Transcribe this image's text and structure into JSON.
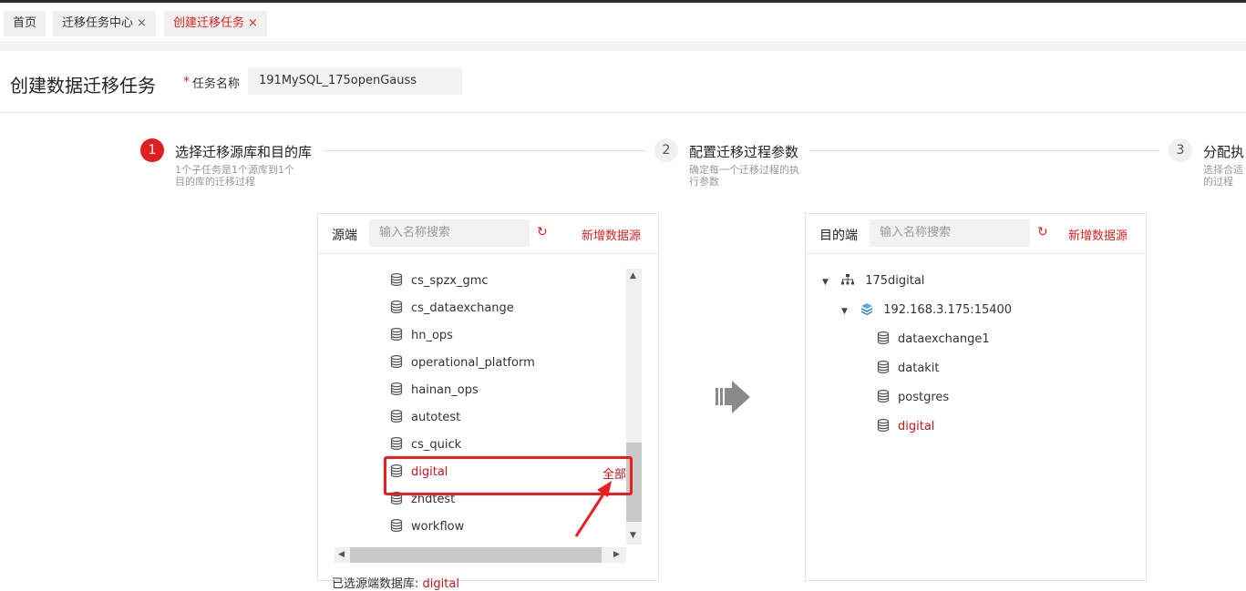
{
  "tabs": [
    {
      "label": "首页",
      "closable": false,
      "active": false
    },
    {
      "label": "迁移任务中心",
      "closable": true,
      "active": false
    },
    {
      "label": "创建迁移任务",
      "closable": true,
      "active": true
    }
  ],
  "close_glyph": "×",
  "page_title": "创建数据迁移任务",
  "task_name": {
    "required_mark": "*",
    "label": "任务名称",
    "value": "191MySQL_175openGauss"
  },
  "steps": [
    {
      "number": "1",
      "title": "选择迁移源库和目的库",
      "desc": "1个子任务是1个源库到1个目的库的迁移过程",
      "active": true
    },
    {
      "number": "2",
      "title": "配置迁移过程参数",
      "desc": "确定每一个迁移过程的执行参数",
      "active": false
    },
    {
      "number": "3",
      "title": "分配执",
      "desc": "选择合适的过程",
      "active": false
    }
  ],
  "source": {
    "title": "源端",
    "search_placeholder": "输入名称搜索",
    "refresh_icon": "refresh-icon",
    "add_label": "新增数据源",
    "databases": [
      "cs_spzx_gmc",
      "cs_dataexchange",
      "hn_ops",
      "operational_platform",
      "hainan_ops",
      "autotest",
      "cs_quick",
      "digital",
      "zhdtest",
      "workflow"
    ],
    "selected": "digital",
    "all_label": "全部",
    "selected_label": "已选源端数据库:",
    "selected_value": "digital"
  },
  "target": {
    "title": "目的端",
    "search_placeholder": "输入名称搜索",
    "refresh_icon": "refresh-icon",
    "add_label": "新增数据源",
    "cluster": "175digital",
    "instance": "192.168.3.175:15400",
    "databases": [
      "dataexchange1",
      "datakit",
      "postgres",
      "digital"
    ],
    "selected": "digital"
  },
  "colors": {
    "accent": "#e02020",
    "selected_text": "#c0151b",
    "annotation": "#ee1d1d"
  }
}
